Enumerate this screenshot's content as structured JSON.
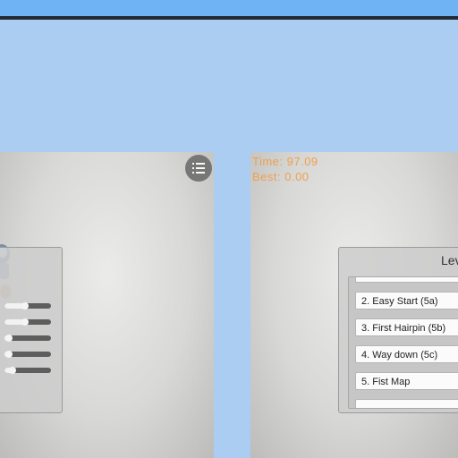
{
  "hud": {
    "time": "Time: 97.09",
    "best": "Best: 0.00"
  },
  "levels": {
    "title": "Lev",
    "items": [
      "",
      "2. Easy Start (5a)",
      "3. First Hairpin (5b)",
      "4. Way down (5c)",
      "5. Fist Map",
      ""
    ]
  },
  "settings": {
    "sliders": [
      0.45,
      0.45,
      0.1,
      0.1,
      0.18
    ]
  },
  "colors": {
    "background": "#abcdf2",
    "topbar": "#70b3f5",
    "hud_text": "#f0a050"
  },
  "icons": {
    "menu": "list-icon"
  }
}
